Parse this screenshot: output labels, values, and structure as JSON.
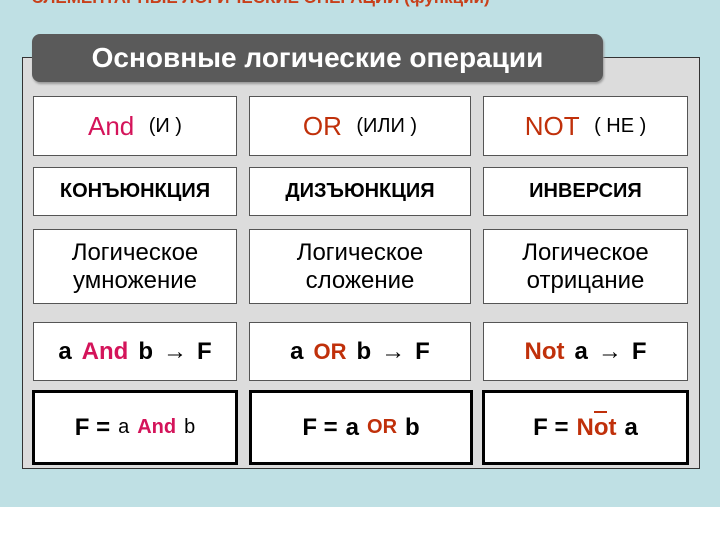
{
  "top_title": "ЭЛЕМЕНТАРНЫЕ  ЛОГИЧЕСКИЕ  ОПЕРАЦИИ (функции)",
  "header": "Основные  логические  операции",
  "columns": [
    {
      "op": "And",
      "op_ru": "(И )",
      "name": "КОНЪЮНКЦИЯ",
      "desc1": "Логическое",
      "desc2": "умножение",
      "expr_a": "a",
      "expr_op": "And",
      "expr_b": "b",
      "arrow": "→",
      "expr_f": "F",
      "formula_f": "F =",
      "formula_a": "a",
      "formula_op": "And",
      "formula_b": "b"
    },
    {
      "op": "OR",
      "op_ru": "(ИЛИ )",
      "name": "ДИЗЪЮНКЦИЯ",
      "desc1": "Логическое",
      "desc2": "сложение",
      "expr_a": "a",
      "expr_op": "OR",
      "expr_b": "b",
      "arrow": "→",
      "expr_f": "F",
      "formula_f": "F =",
      "formula_a": "a",
      "formula_op": "OR",
      "formula_b": "b"
    },
    {
      "op": "NOT",
      "op_ru": "( НЕ )",
      "name": "ИНВЕРСИЯ",
      "desc1": "Логическое",
      "desc2": "отрицание",
      "expr_op": "Not",
      "expr_a": "a",
      "arrow": "→",
      "expr_f": "F",
      "formula_f": "F =",
      "formula_op": "Not",
      "formula_a": "a"
    }
  ],
  "colors": {
    "and": "#d4145a",
    "or_not": "#c0300a",
    "background": "#bfe0e4"
  }
}
